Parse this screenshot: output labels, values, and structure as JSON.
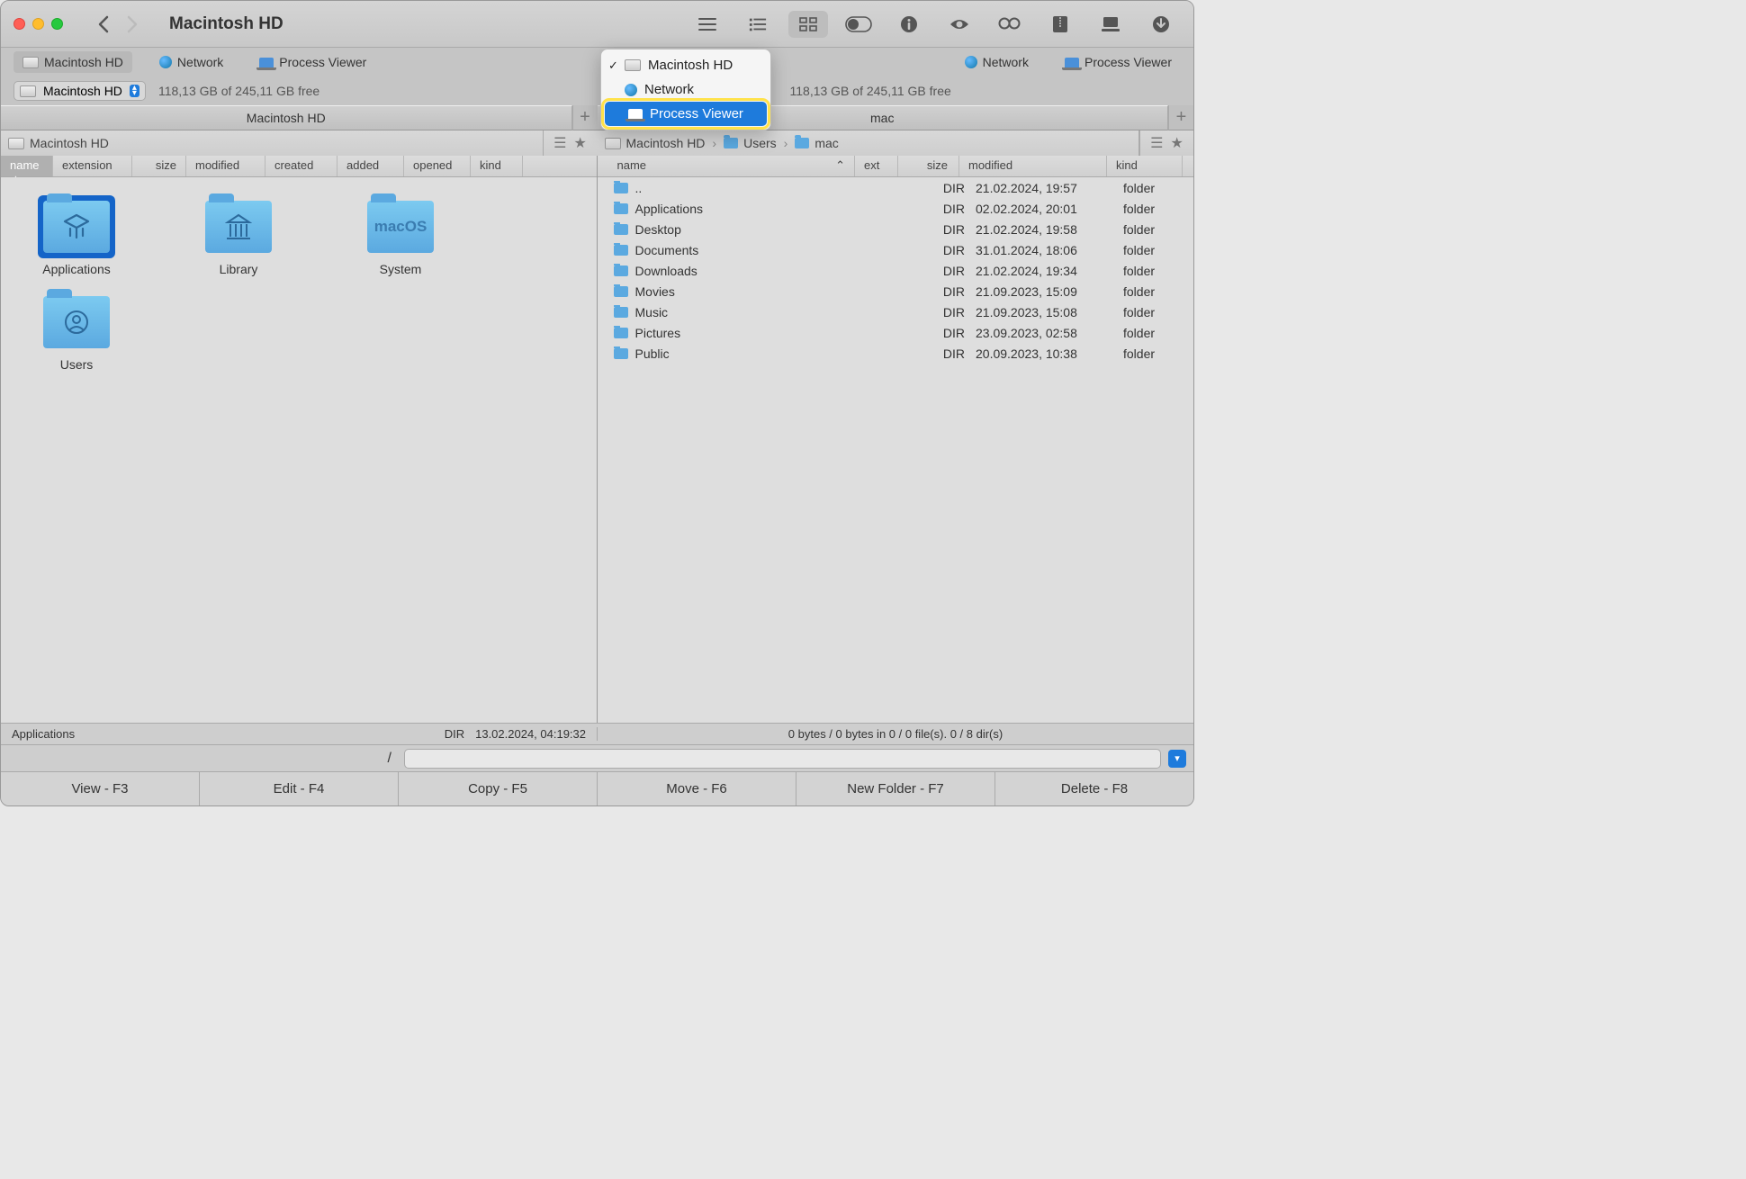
{
  "window": {
    "title": "Macintosh HD"
  },
  "tabs": {
    "left": [
      {
        "label": "Macintosh HD",
        "icon": "hd"
      },
      {
        "label": "Network",
        "icon": "globe"
      },
      {
        "label": "Process Viewer",
        "icon": "laptop"
      }
    ],
    "right": [
      {
        "label": "Network",
        "icon": "globe"
      },
      {
        "label": "Process Viewer",
        "icon": "laptop"
      }
    ]
  },
  "location": {
    "left_label": "Macintosh HD",
    "left_free": "118,13 GB of 245,11 GB free",
    "right_free": "118,13 GB of 245,11 GB free"
  },
  "pane_tabs": {
    "left": "Macintosh HD",
    "right": "mac"
  },
  "breadcrumbs": {
    "left": {
      "parts": [
        "Macintosh HD"
      ]
    },
    "right": {
      "parts": [
        "Macintosh HD",
        "Users",
        "mac"
      ]
    }
  },
  "columns": {
    "left": [
      "name",
      "extension",
      "size",
      "modified",
      "created",
      "added",
      "opened",
      "kind"
    ],
    "right": [
      "name",
      "ext",
      "size",
      "modified",
      "kind"
    ]
  },
  "icon_items": [
    {
      "name": "Applications",
      "glyph": "apps",
      "selected": true
    },
    {
      "name": "Library",
      "glyph": "library",
      "selected": false
    },
    {
      "name": "System",
      "glyph": "macos",
      "selected": false
    },
    {
      "name": "Users",
      "glyph": "user",
      "selected": false
    }
  ],
  "list_rows": [
    {
      "name": "..",
      "ext": "",
      "size": "DIR",
      "modified": "21.02.2024, 19:57",
      "kind": "folder"
    },
    {
      "name": "Applications",
      "ext": "",
      "size": "DIR",
      "modified": "02.02.2024, 20:01",
      "kind": "folder"
    },
    {
      "name": "Desktop",
      "ext": "",
      "size": "DIR",
      "modified": "21.02.2024, 19:58",
      "kind": "folder"
    },
    {
      "name": "Documents",
      "ext": "",
      "size": "DIR",
      "modified": "31.01.2024, 18:06",
      "kind": "folder"
    },
    {
      "name": "Downloads",
      "ext": "",
      "size": "DIR",
      "modified": "21.02.2024, 19:34",
      "kind": "folder"
    },
    {
      "name": "Movies",
      "ext": "",
      "size": "DIR",
      "modified": "21.09.2023, 15:09",
      "kind": "folder"
    },
    {
      "name": "Music",
      "ext": "",
      "size": "DIR",
      "modified": "21.09.2023, 15:08",
      "kind": "folder"
    },
    {
      "name": "Pictures",
      "ext": "",
      "size": "DIR",
      "modified": "23.09.2023, 02:58",
      "kind": "folder"
    },
    {
      "name": "Public",
      "ext": "",
      "size": "DIR",
      "modified": "20.09.2023, 10:38",
      "kind": "folder"
    }
  ],
  "status": {
    "left_name": "Applications",
    "left_size": "DIR",
    "left_date": "13.02.2024, 04:19:32",
    "right_text": "0 bytes / 0 bytes in 0 / 0 file(s). 0 / 8 dir(s)"
  },
  "path": {
    "label": "/"
  },
  "fkeys": [
    "View - F3",
    "Edit - F4",
    "Copy - F5",
    "Move - F6",
    "New Folder - F7",
    "Delete - F8"
  ],
  "dropdown": {
    "items": [
      {
        "label": "Macintosh HD",
        "icon": "hd",
        "checked": true,
        "highlighted": false
      },
      {
        "label": "Network",
        "icon": "globe",
        "checked": false,
        "highlighted": false
      },
      {
        "label": "Process Viewer",
        "icon": "laptop",
        "checked": false,
        "highlighted": true
      }
    ]
  }
}
